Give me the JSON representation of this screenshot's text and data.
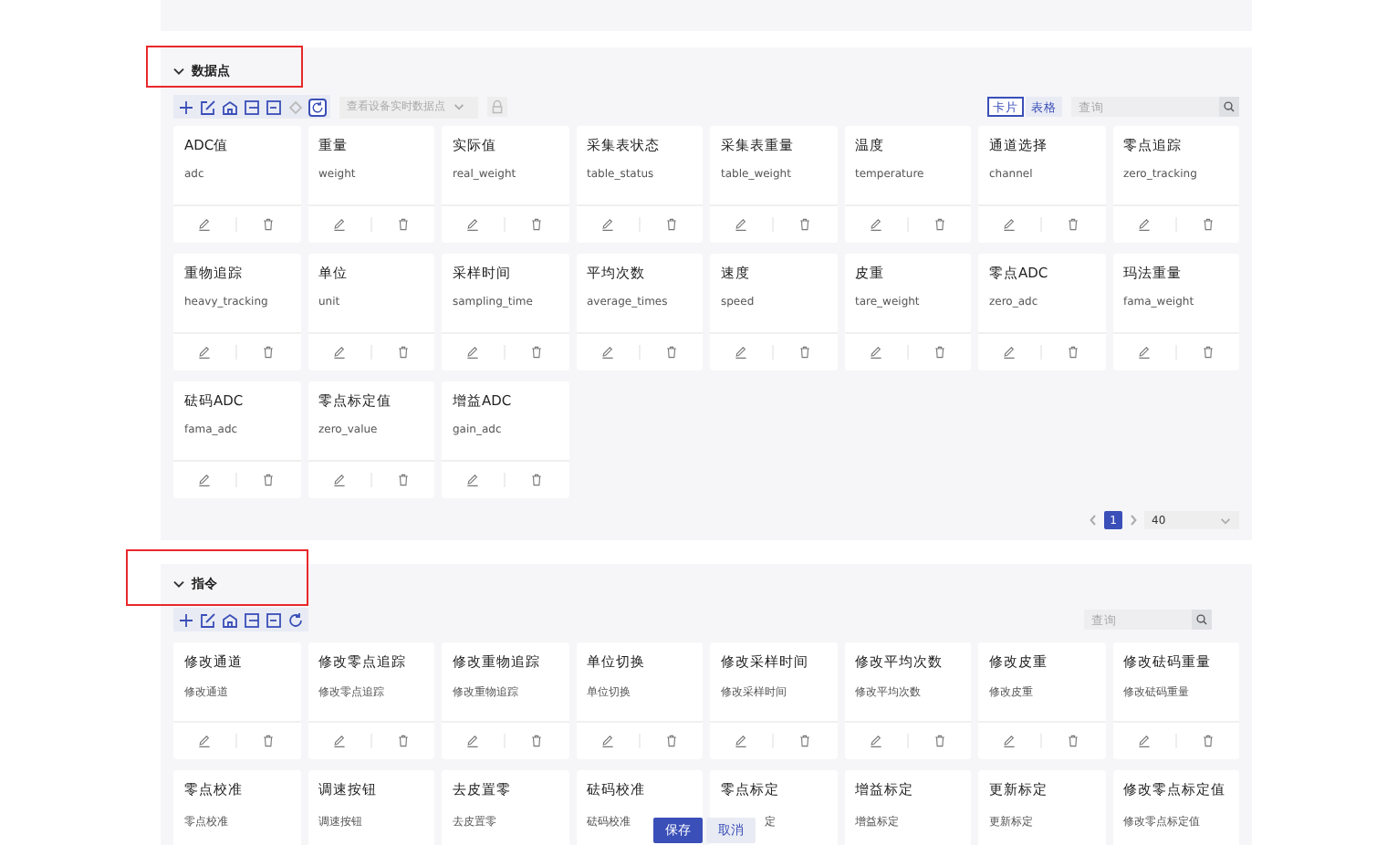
{
  "sections": [
    {
      "title": "数据点",
      "highlighted": true,
      "expanded": true,
      "toolbar": {
        "tools": [
          {
            "kind": "add",
            "disabled": false
          },
          {
            "kind": "edit",
            "disabled": false
          },
          {
            "kind": "home",
            "disabled": false
          },
          {
            "kind": "import",
            "disabled": false
          },
          {
            "kind": "export",
            "disabled": false
          },
          {
            "kind": "diamond",
            "disabled": true
          },
          {
            "kind": "refresh",
            "disabled": false
          }
        ],
        "select": {
          "placeholder": "查看设备实时数据点"
        },
        "extra_button": true,
        "view_toggle": [
          {
            "label": "卡片",
            "selected": true
          },
          {
            "label": "表格",
            "selected": false
          }
        ],
        "search": {
          "placeholder": "查询"
        }
      },
      "cards": [
        {
          "title": "ADC值",
          "field": "adc",
          "kind": "full",
          "actions": true
        },
        {
          "title": "重量",
          "field": "weight",
          "kind": "full",
          "actions": true
        },
        {
          "title": "实际值",
          "field": "real_weight",
          "kind": "full",
          "actions": true
        },
        {
          "title": "采集表状态",
          "field": "table_status",
          "kind": "full",
          "actions": true
        },
        {
          "title": "采集表重量",
          "field": "table_weight",
          "kind": "full",
          "actions": true
        },
        {
          "title": "温度",
          "field": "temperature",
          "kind": "full",
          "actions": true
        },
        {
          "title": "通道选择",
          "field": "channel",
          "kind": "full",
          "actions": true
        },
        {
          "title": "零点追踪",
          "field": "zero_tracking",
          "kind": "full",
          "actions": true
        },
        {
          "title": "重物追踪",
          "field": "heavy_tracking",
          "kind": "full",
          "actions": true
        },
        {
          "title": "单位",
          "field": "unit",
          "kind": "full",
          "actions": true
        },
        {
          "title": "采样时间",
          "field": "sampling_time",
          "kind": "full",
          "actions": true
        },
        {
          "title": "平均次数",
          "field": "average_times",
          "kind": "full",
          "actions": true
        },
        {
          "title": "速度",
          "field": "speed",
          "kind": "full",
          "actions": true
        },
        {
          "title": "皮重",
          "field": "tare_weight",
          "kind": "full",
          "actions": true
        },
        {
          "title": "零点ADC",
          "field": "zero_adc",
          "kind": "full",
          "actions": true
        },
        {
          "title": "玛法重量",
          "field": "fama_weight",
          "kind": "full",
          "actions": true
        },
        {
          "title": "砝码ADC",
          "field": "fama_adc",
          "kind": "full",
          "actions": true
        },
        {
          "title": "零点标定值",
          "field": "zero_value",
          "kind": "full",
          "actions": true
        },
        {
          "title": "增益ADC",
          "field": "gain_adc",
          "kind": "full",
          "actions": true
        }
      ],
      "pagination": {
        "pages": [
          {
            "label": "1",
            "selected": true
          }
        ],
        "page_size": "40"
      }
    },
    {
      "title": "指令",
      "highlighted": true,
      "expanded": true,
      "toolbar": {
        "tools": [
          {
            "kind": "add",
            "disabled": false
          },
          {
            "kind": "edit",
            "disabled": false
          },
          {
            "kind": "home",
            "disabled": false
          },
          {
            "kind": "import",
            "disabled": false
          },
          {
            "kind": "export",
            "disabled": false
          },
          {
            "kind": "refresh",
            "disabled": false
          }
        ],
        "search": {
          "placeholder": "查询"
        }
      },
      "cards": [
        {
          "title": "修改通道",
          "field": "修改通道",
          "kind": "full",
          "actions": true
        },
        {
          "title": "修改零点追踪",
          "field": "修改零点追踪",
          "kind": "full",
          "actions": true
        },
        {
          "title": "修改重物追踪",
          "field": "修改重物追踪",
          "kind": "full",
          "actions": true
        },
        {
          "title": "单位切换",
          "field": "单位切换",
          "kind": "full",
          "actions": true
        },
        {
          "title": "修改采样时间",
          "field": "修改采样时间",
          "kind": "full",
          "actions": true
        },
        {
          "title": "修改平均次数",
          "field": "修改平均次数",
          "kind": "full",
          "actions": true
        },
        {
          "title": "修改皮重",
          "field": "修改皮重",
          "kind": "full",
          "actions": true
        },
        {
          "title": "修改砝码重量",
          "field": "修改砝码重量",
          "kind": "full",
          "actions": true
        },
        {
          "title": "零点校准",
          "field": "零点校准",
          "kind": "full",
          "actions": false
        },
        {
          "title": "调速按钮",
          "field": "调速按钮",
          "kind": "full",
          "actions": false
        },
        {
          "title": "去皮置零",
          "field": "去皮置零",
          "kind": "full",
          "actions": false
        },
        {
          "title": "砝码校准",
          "field": "砝码校准",
          "kind": "full",
          "actions": false
        },
        {
          "title": "零点标定",
          "field": "定",
          "kind": "partial",
          "actions": false
        },
        {
          "title": "增益标定",
          "field": "增益标定",
          "kind": "full",
          "actions": false
        },
        {
          "title": "更新标定",
          "field": "更新标定",
          "kind": "full",
          "actions": false
        },
        {
          "title": "修改零点标定值",
          "field": "修改零点标定值",
          "kind": "full",
          "actions": false
        }
      ]
    }
  ],
  "floating_buttons": [
    {
      "label": "保存",
      "kind": "primary"
    },
    {
      "label": "取消",
      "kind": "secondary"
    }
  ]
}
